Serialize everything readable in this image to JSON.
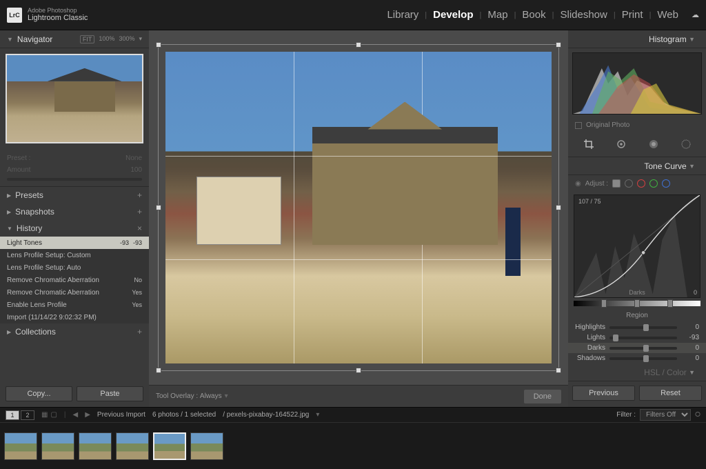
{
  "app": {
    "brand": "Adobe Photoshop",
    "name": "Lightroom Classic",
    "logo": "LrC"
  },
  "modules": [
    "Library",
    "Develop",
    "Map",
    "Book",
    "Slideshow",
    "Print",
    "Web"
  ],
  "active_module": "Develop",
  "left": {
    "navigator": {
      "title": "Navigator",
      "fit": "FIT",
      "zoom1": "100%",
      "zoom2": "300%"
    },
    "preset_label": "Preset :",
    "preset_value": "None",
    "amount_label": "Amount",
    "amount_value": "100",
    "presets": "Presets",
    "snapshots": "Snapshots",
    "history": "History",
    "history_items": [
      {
        "name": "Light Tones",
        "v1": "-93",
        "v2": "-93",
        "sel": true
      },
      {
        "name": "Lens Profile Setup: Custom",
        "v1": "",
        "v2": ""
      },
      {
        "name": "Lens Profile Setup: Auto",
        "v1": "",
        "v2": ""
      },
      {
        "name": "Remove Chromatic Aberration",
        "v1": "",
        "v2": "No"
      },
      {
        "name": "Remove Chromatic Aberration",
        "v1": "",
        "v2": "Yes"
      },
      {
        "name": "Enable Lens Profile",
        "v1": "",
        "v2": "Yes"
      },
      {
        "name": "Import (11/14/22 9:02:32 PM)",
        "v1": "",
        "v2": ""
      }
    ],
    "collections": "Collections",
    "copy_btn": "Copy...",
    "paste_btn": "Paste"
  },
  "center": {
    "tool_overlay_label": "Tool Overlay :",
    "tool_overlay_value": "Always",
    "done": "Done"
  },
  "right": {
    "histogram": "Histogram",
    "original_photo": "Original Photo",
    "tone_curve": "Tone Curve",
    "adjust_label": "Adjust :",
    "curve_readout": "107 / 75",
    "curve_region": "Darks",
    "curve_zero": "0",
    "region_label": "Region",
    "sliders": [
      {
        "name": "Highlights",
        "value": "0",
        "pos": 50
      },
      {
        "name": "Lights",
        "value": "-93",
        "pos": 5
      },
      {
        "name": "Darks",
        "value": "0",
        "pos": 50,
        "sel": true
      },
      {
        "name": "Shadows",
        "value": "0",
        "pos": 50
      }
    ],
    "hsl_label": "HSL / Color",
    "previous": "Previous",
    "reset": "Reset"
  },
  "filmstrip": {
    "screens": [
      "1",
      "2"
    ],
    "breadcrumb": "Previous Import",
    "count": "6 photos / 1 selected",
    "filename": "/ pexels-pixabay-164522.jpg",
    "filter_label": "Filter :",
    "filter_value": "Filters Off",
    "thumb_count": 6,
    "selected_index": 4
  }
}
